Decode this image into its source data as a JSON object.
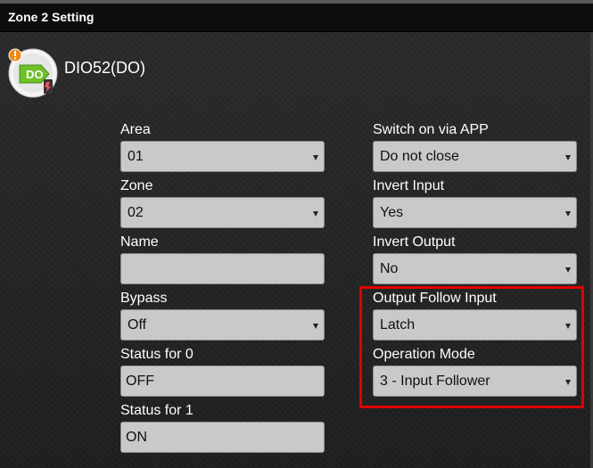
{
  "window": {
    "title": "Zone 2 Setting"
  },
  "device": {
    "name": "DIO52(DO)",
    "icon": "do-output-icon",
    "icon_text": "DO"
  },
  "form": {
    "area": {
      "label": "Area",
      "value": "01"
    },
    "zone": {
      "label": "Zone",
      "value": "02"
    },
    "name": {
      "label": "Name",
      "value": ""
    },
    "bypass": {
      "label": "Bypass",
      "value": "Off"
    },
    "status0": {
      "label": "Status for 0",
      "value": "OFF"
    },
    "status1": {
      "label": "Status for 1",
      "value": "ON"
    },
    "switch_app": {
      "label": "Switch on via APP",
      "value": "Do not close"
    },
    "invert_input": {
      "label": "Invert Input",
      "value": "Yes"
    },
    "invert_output": {
      "label": "Invert Output",
      "value": "No"
    },
    "output_follow": {
      "label": "Output Follow Input",
      "value": "Latch"
    },
    "operation_mode": {
      "label": "Operation Mode",
      "value": "3 - Input Follower"
    }
  },
  "colors": {
    "highlight": "#e00000",
    "titlebar": "#0d0d0d",
    "field": "#c9c9c9"
  }
}
